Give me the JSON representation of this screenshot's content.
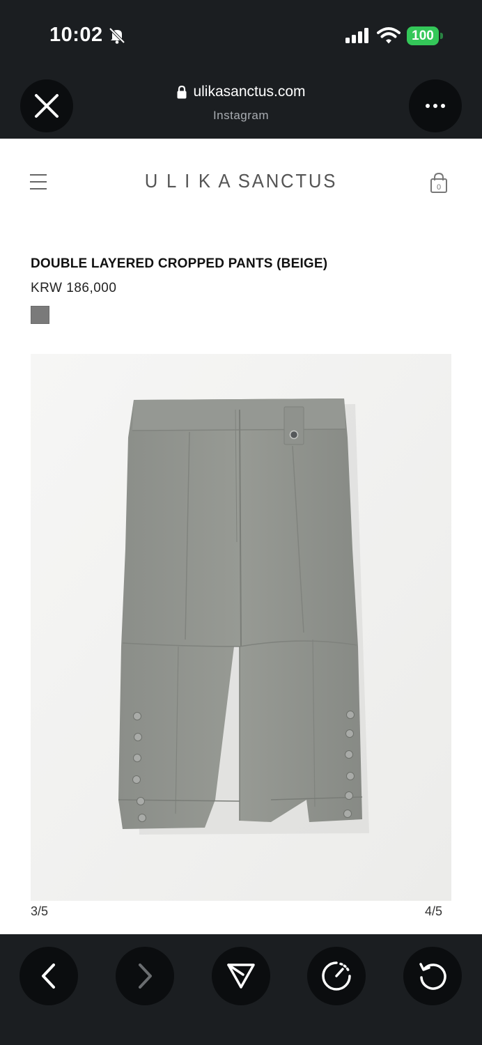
{
  "status_bar": {
    "time": "10:02",
    "battery": "100",
    "icons": [
      "bell-slash-icon",
      "signal-icon",
      "wifi-icon",
      "battery-icon"
    ]
  },
  "browser": {
    "url": "ulikasanctus.com",
    "source_app": "Instagram",
    "icons": [
      "close-icon",
      "more-icon",
      "lock-icon"
    ]
  },
  "site_header": {
    "logo": "U L I K A SANCTUS",
    "cart_count": "0",
    "icons": [
      "hamburger-menu-icon",
      "cart-bag-icon"
    ]
  },
  "product": {
    "title": "DOUBLE LAYERED CROPPED PANTS (BEIGE)",
    "price": "KRW 186,000",
    "swatch_color": "#7a7a7a",
    "image_subject": "grey-cropped-pants-photo"
  },
  "gallery": {
    "left_counter": "3/5",
    "right_counter": "4/5"
  },
  "toolbar": {
    "icons": [
      "back-icon",
      "forward-icon",
      "share-icon",
      "speedometer-icon",
      "reload-icon"
    ]
  },
  "colors": {
    "chrome_dark": "#1b1e21",
    "battery_green": "#34c759",
    "pants_grey": "#8f928d"
  }
}
